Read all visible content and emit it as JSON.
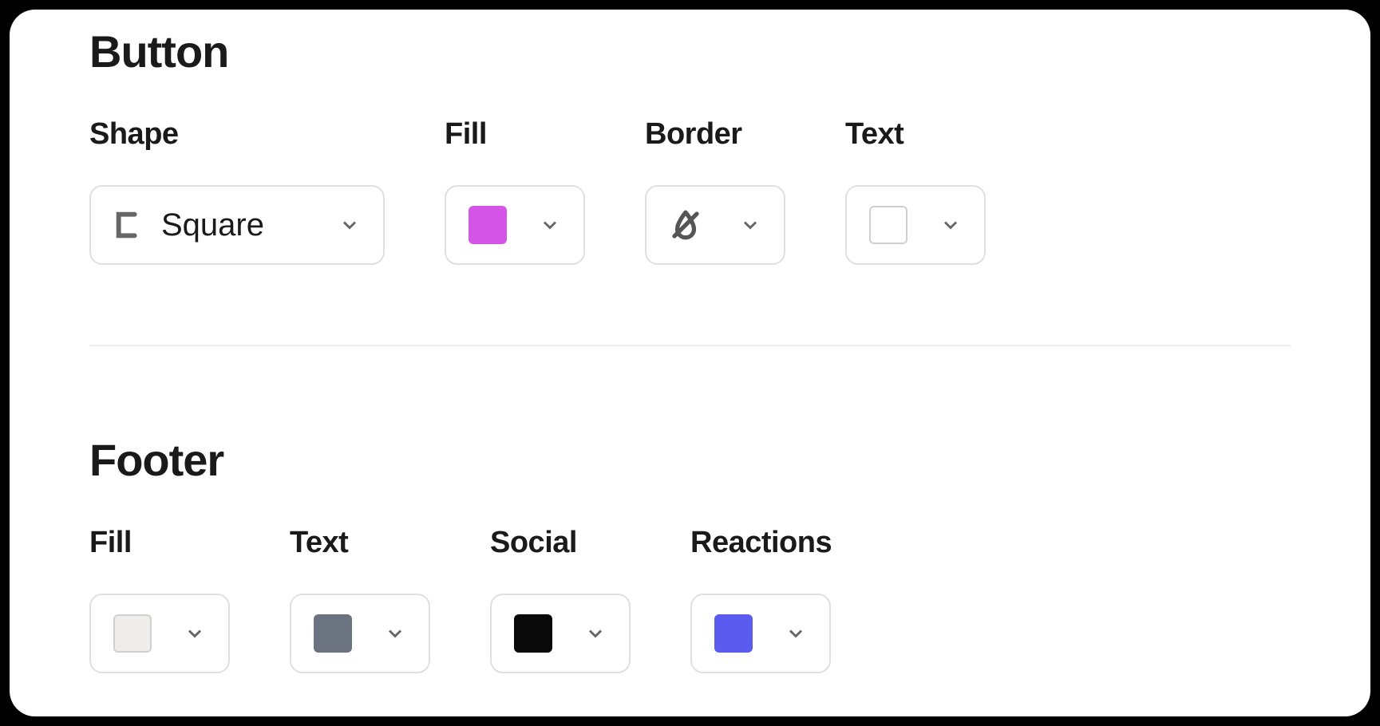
{
  "button_section": {
    "title": "Button",
    "shape": {
      "label": "Shape",
      "value": "Square"
    },
    "fill": {
      "label": "Fill",
      "color": "#d455e8"
    },
    "border": {
      "label": "Border",
      "color": null
    },
    "text": {
      "label": "Text",
      "color": "#ffffff"
    }
  },
  "footer_section": {
    "title": "Footer",
    "fill": {
      "label": "Fill",
      "color": "#efedec"
    },
    "text": {
      "label": "Text",
      "color": "#6b7280"
    },
    "social": {
      "label": "Social",
      "color": "#0a0a0a"
    },
    "reactions": {
      "label": "Reactions",
      "color": "#5b5bf0"
    }
  }
}
